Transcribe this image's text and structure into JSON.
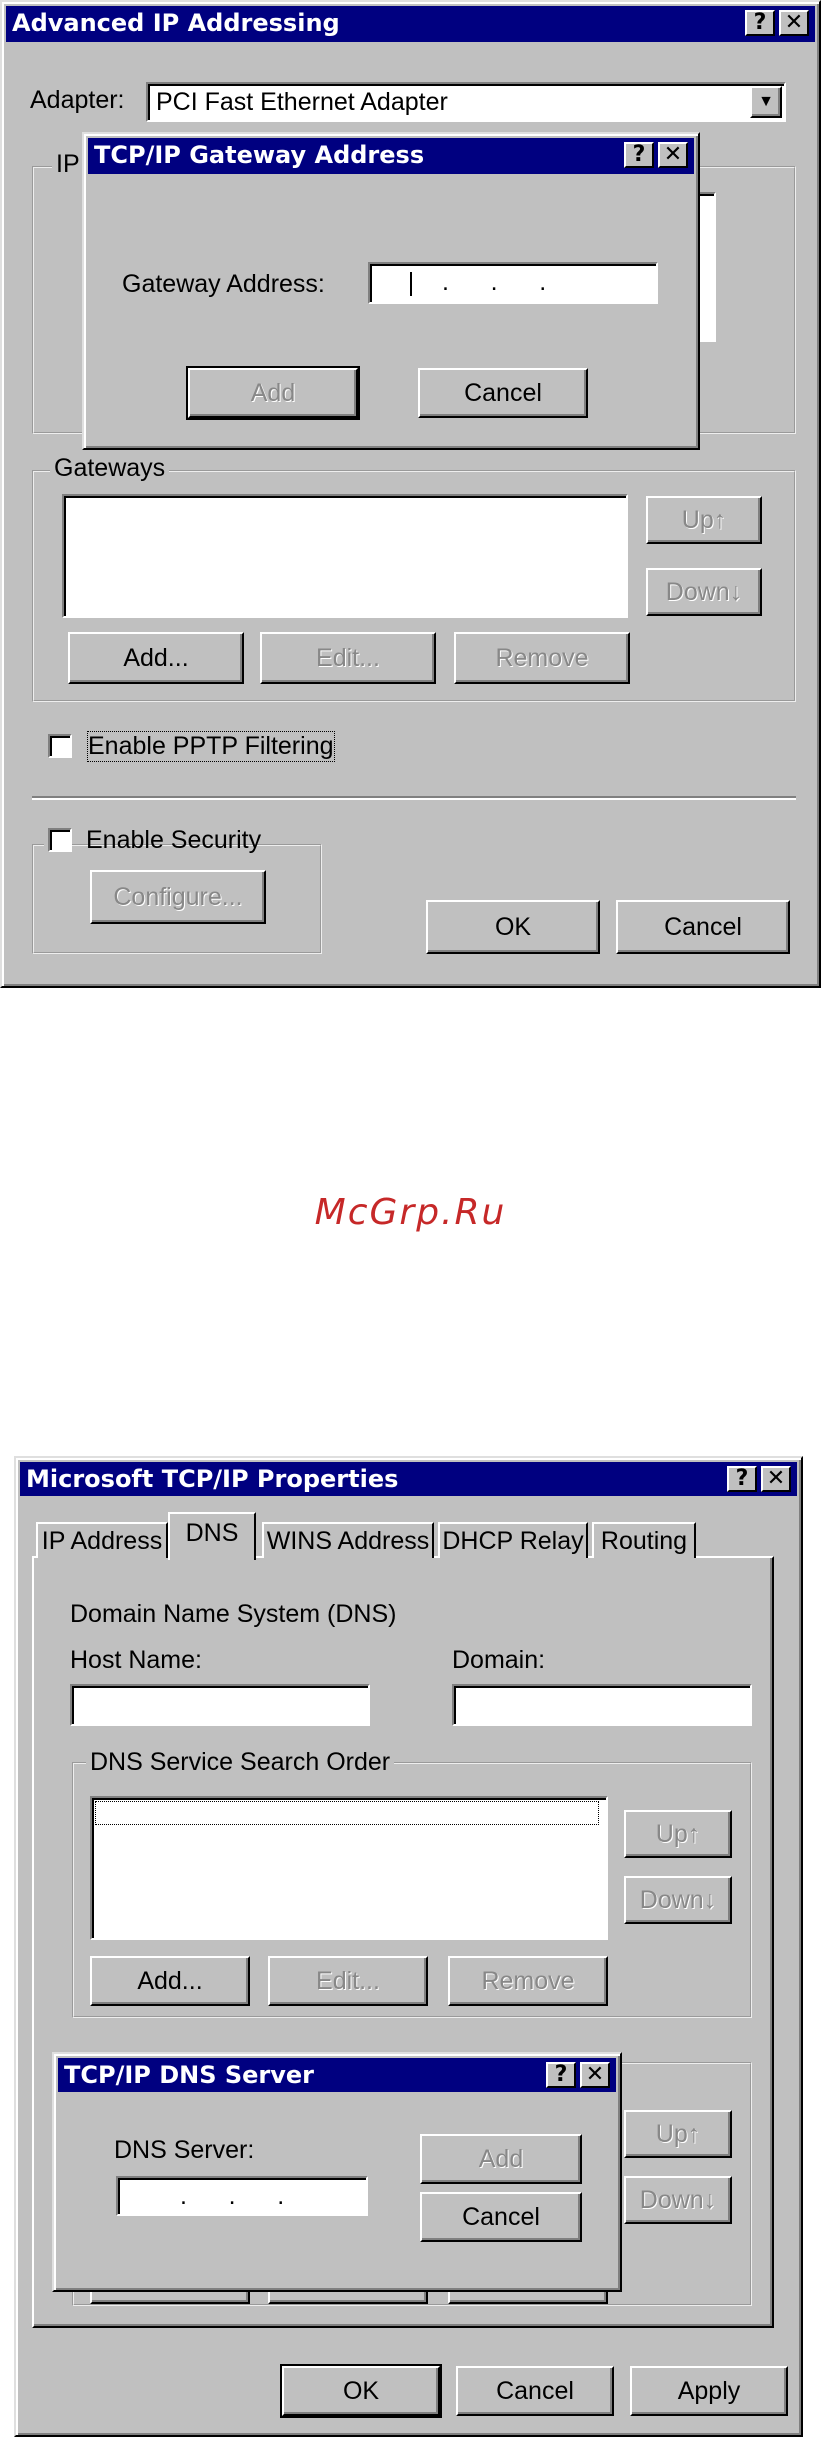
{
  "window1": {
    "title": "Advanced IP Addressing",
    "help_label": "?",
    "close_label": "✕",
    "adapter_label": "Adapter:",
    "adapter_value": "PCI Fast Ethernet Adapter",
    "ip_group_label": "IP",
    "gateways_label": "Gateways",
    "add_label": "Add...",
    "edit_label": "Edit...",
    "remove_label": "Remove",
    "up_label": "Up↑",
    "down_label": "Down↓",
    "pptp_label": "Enable PPTP Filtering",
    "security_label": "Enable Security",
    "configure_label": "Configure...",
    "ok_label": "OK",
    "cancel_label": "Cancel"
  },
  "gateway_dialog": {
    "title": "TCP/IP Gateway Address",
    "help_label": "?",
    "close_label": "✕",
    "field_label": "Gateway Address:",
    "ip_dots": ".      .      .",
    "add_label": "Add",
    "cancel_label": "Cancel"
  },
  "watermark": "McGrp.Ru",
  "window2": {
    "title": "Microsoft TCP/IP Properties",
    "help_label": "?",
    "close_label": "✕",
    "tabs": [
      "IP Address",
      "DNS",
      "WINS Address",
      "DHCP Relay",
      "Routing"
    ],
    "dns_heading": "Domain Name System (DNS)",
    "host_label": "Host Name:",
    "domain_label": "Domain:",
    "dns_order_label": "DNS Service Search Order",
    "add_label": "Add...",
    "edit_label": "Edit...",
    "remove_label": "Remove",
    "up_label": "Up↑",
    "down_label": "Down↓",
    "up2_label": "Up↑",
    "down2_label": "Down↓",
    "ok_label": "OK",
    "cancel_label": "Cancel",
    "apply_label": "Apply"
  },
  "dns_dialog": {
    "title": "TCP/IP DNS Server",
    "help_label": "?",
    "close_label": "✕",
    "field_label": "DNS Server:",
    "ip_dots": ".      .      .",
    "add_label": "Add",
    "cancel_label": "Cancel"
  }
}
